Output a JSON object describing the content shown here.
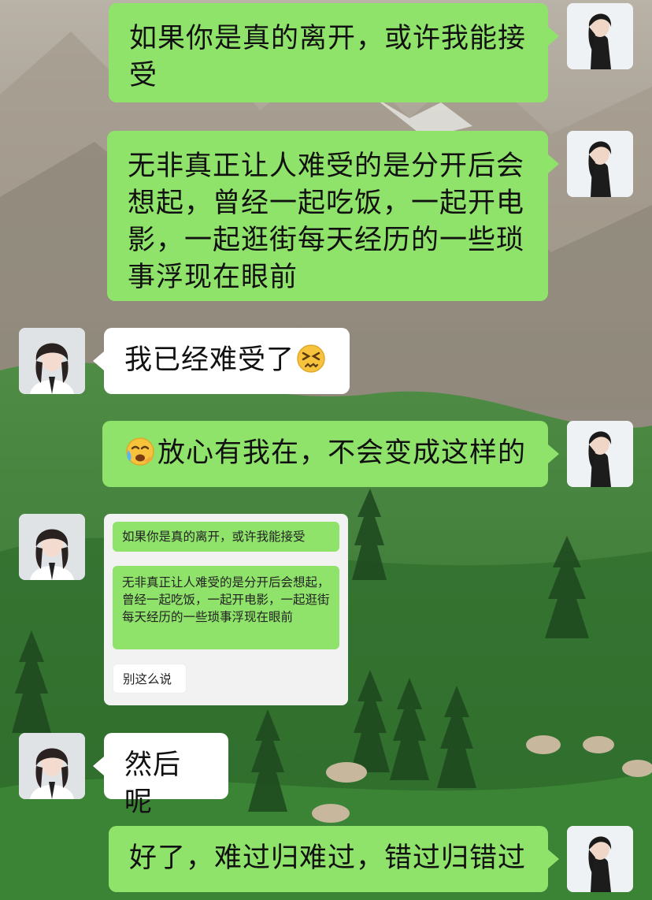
{
  "messages": [
    {
      "side": "right",
      "text": "如果你是真的离开，或许我能接受"
    },
    {
      "side": "right",
      "text": "无非真正让人难受的是分开后会想起，曾经一起吃饭，一起开电影，一起逛街每天经历的一些琐事浮现在眼前"
    },
    {
      "side": "left",
      "text": "我已经难受了",
      "emoji": "persevering-face-icon"
    },
    {
      "side": "right",
      "text": "放心有我在，不会变成这样的",
      "emoji": "crying-face-icon"
    },
    {
      "side": "left",
      "type": "quoted-screenshot",
      "quoted": [
        {
          "text": "如果你是真的离开，或许我能接受"
        },
        {
          "text": "无非真正让人难受的是分开后会想起，曾经一起吃饭，一起开电影，一起逛街每天经历的一些琐事浮现在眼前"
        },
        {
          "text": "别这么说"
        }
      ]
    },
    {
      "side": "left",
      "text": "然后呢"
    },
    {
      "side": "right",
      "text": "好了，难过归难过，错过归错过"
    }
  ],
  "colors": {
    "green_bubble": "#8fe36a",
    "white_bubble": "#ffffff"
  }
}
